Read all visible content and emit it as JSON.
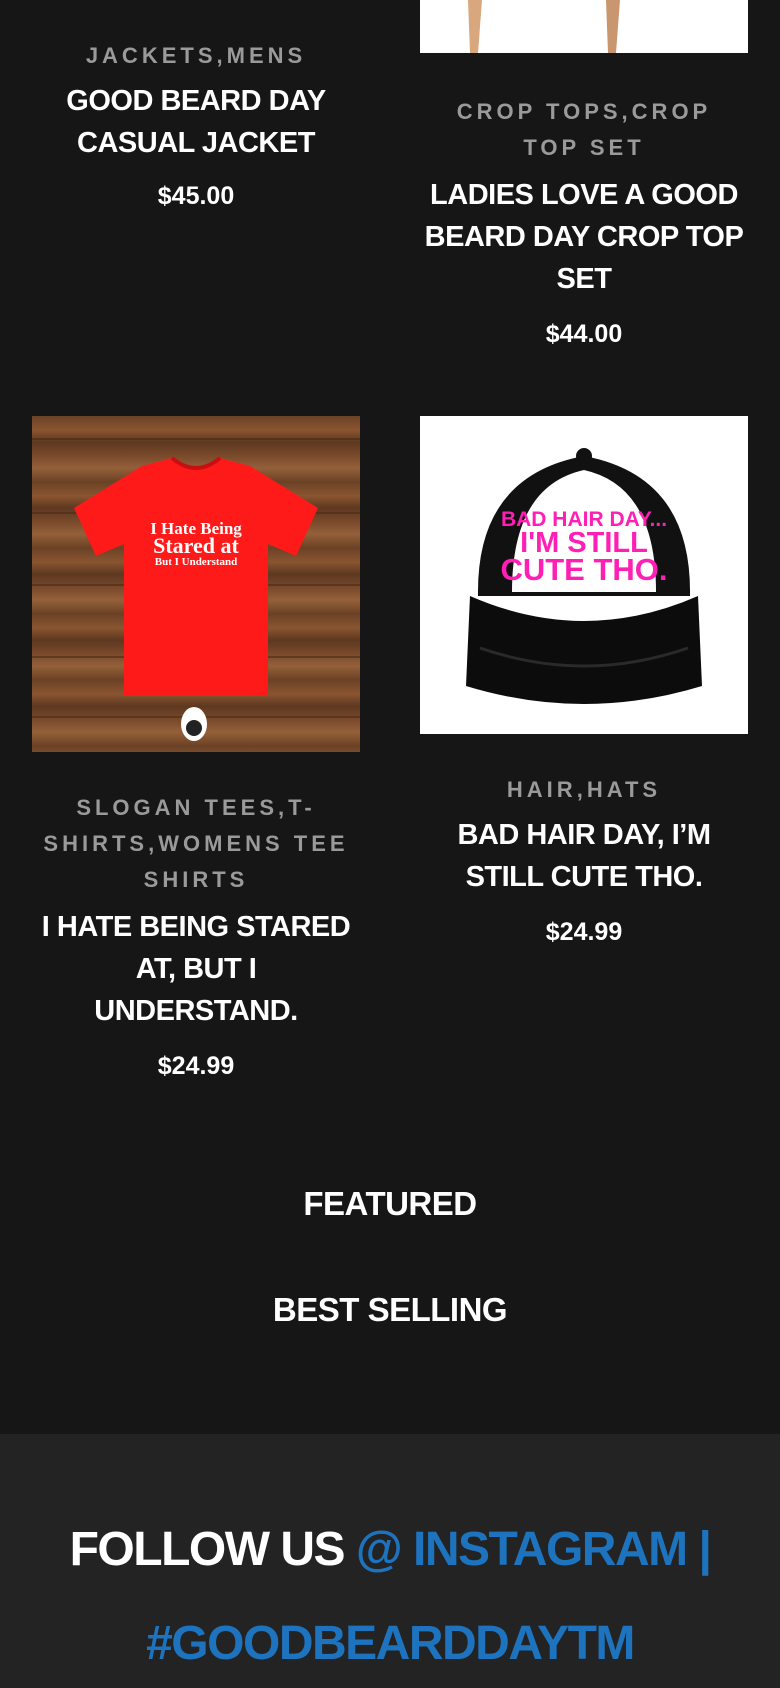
{
  "products": [
    {
      "categories": [
        "JACKETS",
        "MENS"
      ],
      "title": "GOOD BEARD DAY CASUAL JACKET",
      "price": "$45.00"
    },
    {
      "categories": [
        "CROP TOPS",
        "CROP TOP SET"
      ],
      "title": "LADIES LOVE A GOOD BEARD DAY CROP TOP SET",
      "price": "$44.00"
    },
    {
      "categories": [
        "SLOGAN TEES",
        "T-SHIRTS",
        "WOMENS TEE SHIRTS"
      ],
      "title": "I HATE BEING STARED AT, BUT I UNDERSTAND.",
      "price": "$24.99",
      "image_text": [
        "I Hate Being",
        "Stared at",
        "But I Understand"
      ]
    },
    {
      "categories": [
        "HAIR",
        "HATS"
      ],
      "title": "BAD HAIR DAY, I’M STILL CUTE THO.",
      "price": "$24.99",
      "image_text": [
        "BAD HAIR DAY...",
        "I'M STILL",
        "CUTE THO."
      ]
    }
  ],
  "sections": {
    "featured": "FEATURED",
    "best_selling": "BEST SELLING"
  },
  "footer": {
    "follow_text": "FOLLOW US",
    "instagram_link": "@ INSTAGRAM |",
    "hashtag": "#GOODBEARDDAYTM"
  },
  "colors": {
    "background": "#161616",
    "footer_background": "#232323",
    "link_blue": "#1e73be",
    "category_gray": "#9a9a9a",
    "tee_red": "#ff1a1a",
    "cap_pink": "#ff1fb4"
  }
}
